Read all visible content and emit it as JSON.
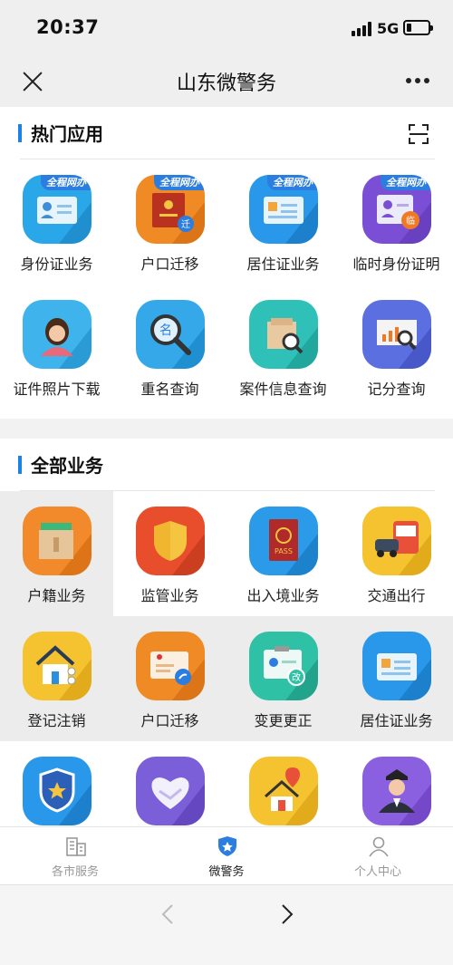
{
  "status_bar": {
    "time": "20:37",
    "network": "5G"
  },
  "nav": {
    "title": "山东微警务"
  },
  "hot_section": {
    "title": "热门应用",
    "badge": "全程网办",
    "items": [
      {
        "label": "身份证业务",
        "icon": "id-card-icon"
      },
      {
        "label": "户口迁移",
        "icon": "household-register-icon"
      },
      {
        "label": "居住证业务",
        "icon": "residence-permit-icon"
      },
      {
        "label": "临时身份证明",
        "icon": "temporary-id-icon"
      },
      {
        "label": "证件照片下载",
        "icon": "photo-download-icon"
      },
      {
        "label": "重名查询",
        "icon": "name-search-icon"
      },
      {
        "label": "案件信息查询",
        "icon": "case-search-icon"
      },
      {
        "label": "记分查询",
        "icon": "score-query-icon"
      }
    ]
  },
  "all_section": {
    "title": "全部业务",
    "items": [
      {
        "label": "户籍业务",
        "icon": "household-folder-icon"
      },
      {
        "label": "监管业务",
        "icon": "shield-icon"
      },
      {
        "label": "出入境业务",
        "icon": "passport-icon"
      },
      {
        "label": "交通出行",
        "icon": "traffic-icon"
      },
      {
        "label": "登记注销",
        "icon": "house-register-icon"
      },
      {
        "label": "户口迁移",
        "icon": "migration-card-icon"
      },
      {
        "label": "变更更正",
        "icon": "change-card-icon"
      },
      {
        "label": "居住证业务",
        "icon": "residence-card-icon"
      },
      {
        "label": "",
        "icon": "police-badge-icon"
      },
      {
        "label": "",
        "icon": "handshake-icon"
      },
      {
        "label": "",
        "icon": "location-house-icon"
      },
      {
        "label": "",
        "icon": "police-officer-icon"
      }
    ]
  },
  "tabbar": {
    "tabs": [
      {
        "label": "各市服务",
        "icon": "building-icon",
        "active": false
      },
      {
        "label": "微警务",
        "icon": "police-shield-icon",
        "active": true
      },
      {
        "label": "个人中心",
        "icon": "person-icon",
        "active": false
      }
    ]
  },
  "colors": {
    "accent": "#1a82e6",
    "badge": "#2b7de0"
  }
}
